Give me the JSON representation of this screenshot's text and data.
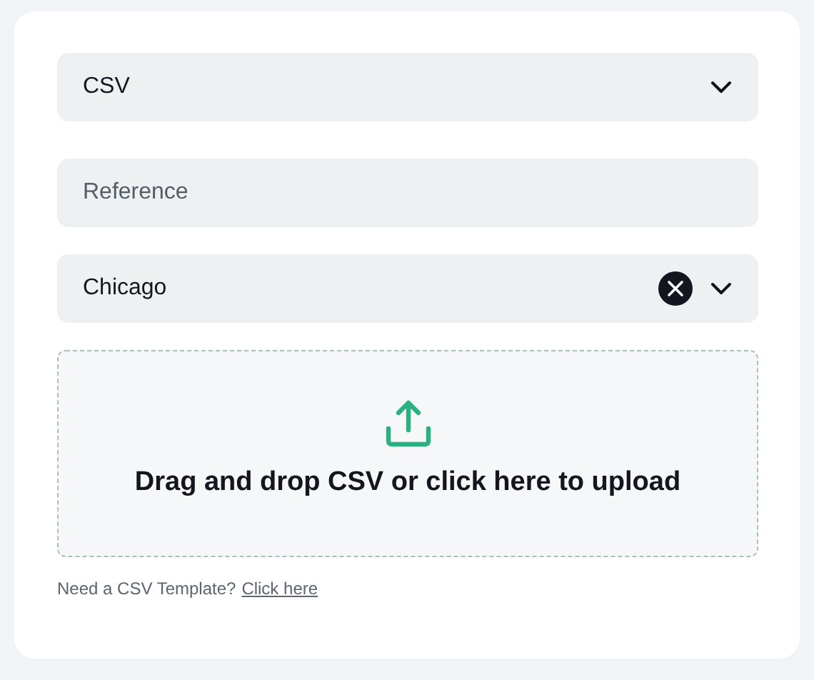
{
  "format_select": {
    "value": "CSV"
  },
  "reference_field": {
    "placeholder": "Reference"
  },
  "location_select": {
    "value": "Chicago",
    "clearable": true
  },
  "dropzone": {
    "text": "Drag and drop CSV or click here to upload"
  },
  "template_hint": {
    "text": "Need a CSV Template?",
    "link": "Click here"
  }
}
